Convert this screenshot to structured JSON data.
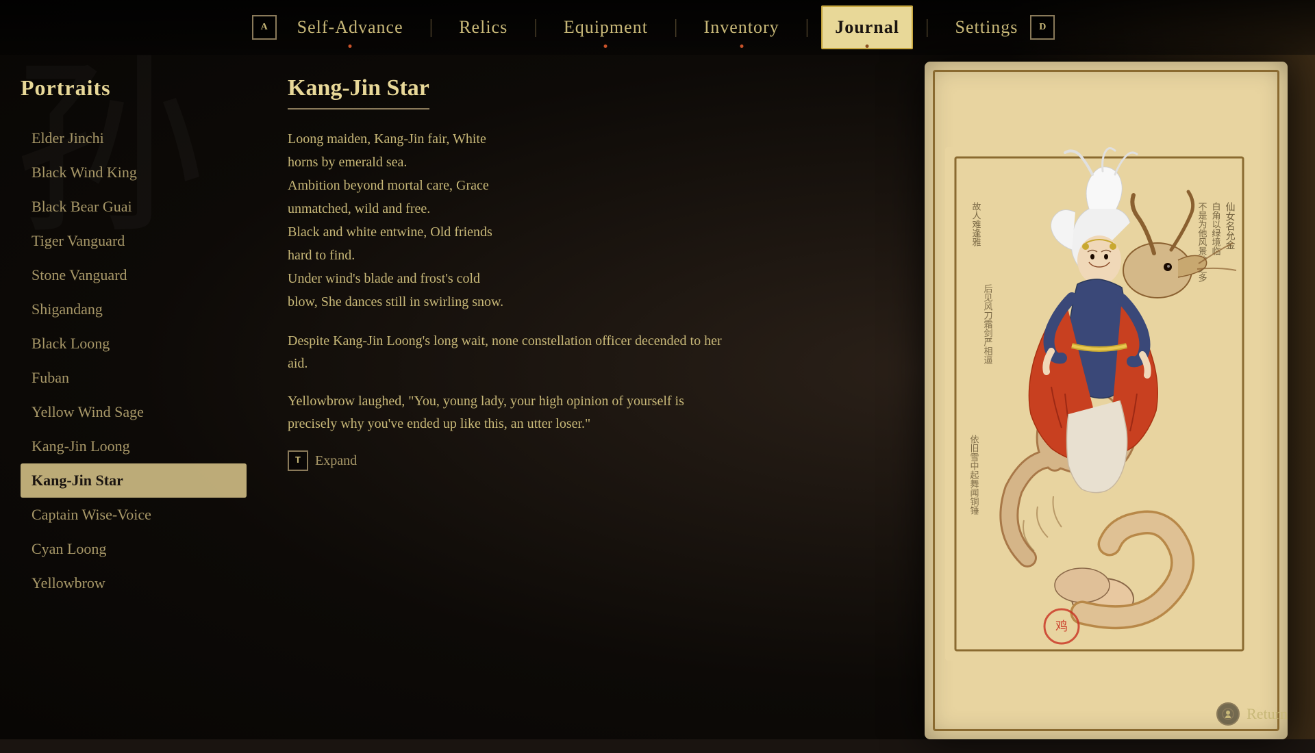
{
  "nav": {
    "left_key": "A",
    "right_key": "D",
    "items": [
      {
        "id": "self-advance",
        "label": "Self-Advance",
        "active": false,
        "dot": true
      },
      {
        "id": "relics",
        "label": "Relics",
        "active": false,
        "dot": false
      },
      {
        "id": "equipment",
        "label": "Equipment",
        "active": false,
        "dot": true
      },
      {
        "id": "inventory",
        "label": "Inventory",
        "active": false,
        "dot": true
      },
      {
        "id": "journal",
        "label": "Journal",
        "active": true,
        "dot": true
      },
      {
        "id": "settings",
        "label": "Settings",
        "active": false,
        "dot": false
      }
    ]
  },
  "sidebar": {
    "title": "Portraits",
    "items": [
      {
        "id": "elder-jinchi",
        "label": "Elder Jinchi",
        "active": false
      },
      {
        "id": "black-wind-king",
        "label": "Black Wind King",
        "active": false
      },
      {
        "id": "black-bear-guai",
        "label": "Black Bear Guai",
        "active": false
      },
      {
        "id": "tiger-vanguard",
        "label": "Tiger Vanguard",
        "active": false
      },
      {
        "id": "stone-vanguard",
        "label": "Stone Vanguard",
        "active": false
      },
      {
        "id": "shigandang",
        "label": "Shigandang",
        "active": false
      },
      {
        "id": "black-loong",
        "label": "Black Loong",
        "active": false
      },
      {
        "id": "fuban",
        "label": "Fuban",
        "active": false
      },
      {
        "id": "yellow-wind-sage",
        "label": "Yellow Wind Sage",
        "active": false
      },
      {
        "id": "kang-jin-loong",
        "label": "Kang-Jin Loong",
        "active": false
      },
      {
        "id": "kang-jin-star",
        "label": "Kang-Jin Star",
        "active": true
      },
      {
        "id": "captain-wise-voice",
        "label": "Captain Wise-Voice",
        "active": false
      },
      {
        "id": "cyan-loong",
        "label": "Cyan Loong",
        "active": false
      },
      {
        "id": "yellowbrow",
        "label": "Yellowbrow",
        "active": false
      }
    ]
  },
  "entry": {
    "title": "Kang-Jin Star",
    "poem_lines": [
      "Loong maiden, Kang-Jin fair, White",
      "horns by emerald sea.",
      "Ambition beyond mortal care, Grace",
      "unmatched, wild and free.",
      "Black and white entwine, Old friends",
      "hard to find.",
      "Under wind's blade and frost's cold",
      "blow, She dances still in swirling snow."
    ],
    "body_paragraphs": [
      "Despite Kang-Jin Loong's long wait, none constellation officer decended to her aid.",
      "Yellowbrow laughed, \"You, young lady, your high opinion of yourself is precisely why you've ended up like this, an utter loser.\""
    ]
  },
  "expand_button": {
    "key": "T",
    "label": "Expand"
  },
  "return_button": {
    "label": "Return"
  },
  "watermark": {
    "character": "孙"
  }
}
